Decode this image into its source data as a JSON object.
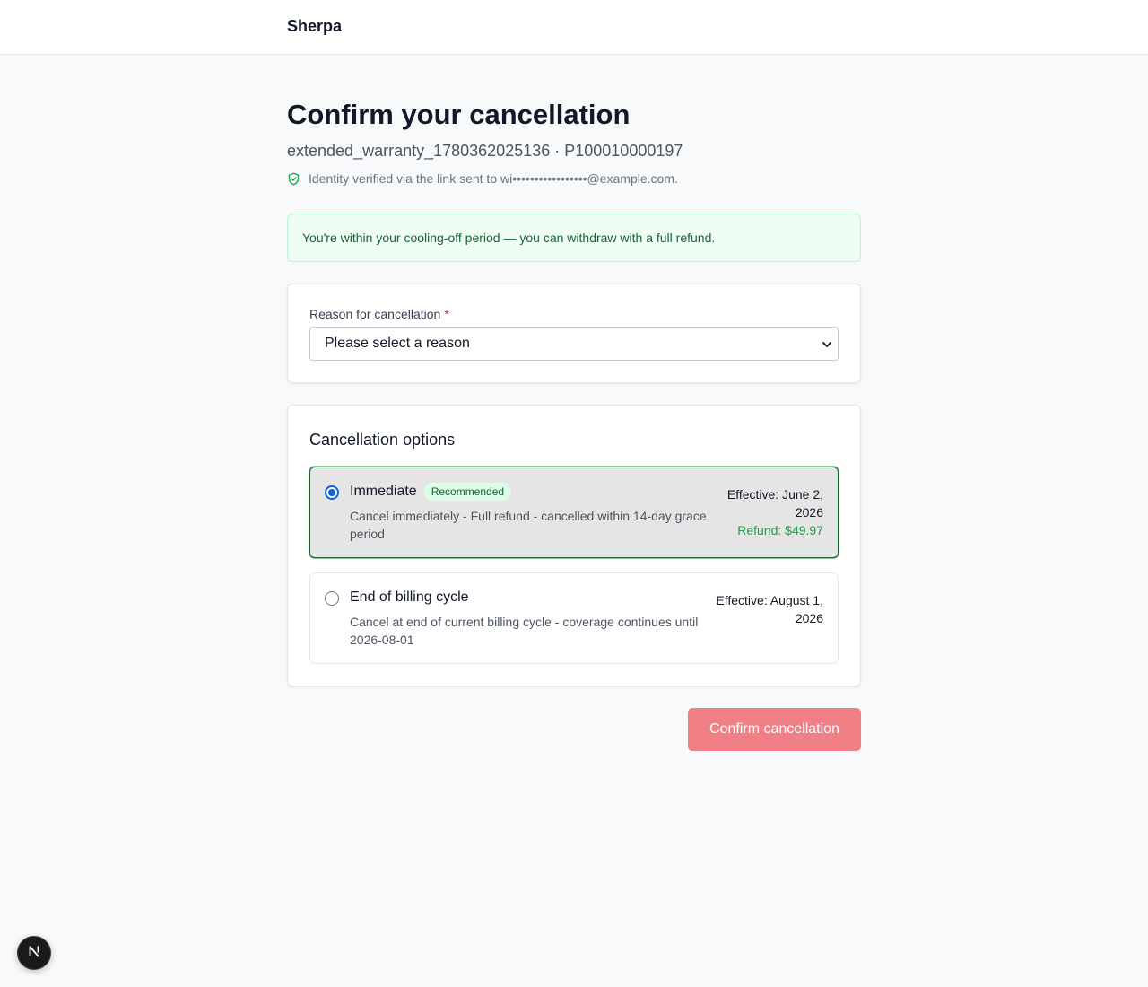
{
  "header": {
    "brand": "Sherpa"
  },
  "page": {
    "title": "Confirm your cancellation",
    "subtitle": "extended_warranty_1780362025136 · P100010000197",
    "verification": "Identity verified via the link sent to wi•••••••••••••••••@example.com.",
    "verification_icon": "shield-check-icon"
  },
  "alert": {
    "text": "You're within your cooling-off period — you can withdraw with a full refund.",
    "color": "#166534"
  },
  "reason": {
    "label": "Reason for cancellation",
    "required_mark": "*",
    "selected": "Please select a reason"
  },
  "options": {
    "title": "Cancellation options",
    "items": [
      {
        "title": "Immediate",
        "badge": "Recommended",
        "description": "Cancel immediately - Full refund - cancelled within 14-day grace period",
        "effective": "Effective: June 2, 2026",
        "refund": "Refund: $49.97",
        "selected": true
      },
      {
        "title": "End of billing cycle",
        "description": "Cancel at end of current billing cycle - coverage continues until 2026-08-01",
        "effective": "Effective: August 1, 2026",
        "selected": false
      }
    ]
  },
  "actions": {
    "confirm_label": "Confirm cancellation",
    "confirm_color": "#f17f86"
  },
  "dev_badge": {
    "icon": "next-logo-icon"
  }
}
